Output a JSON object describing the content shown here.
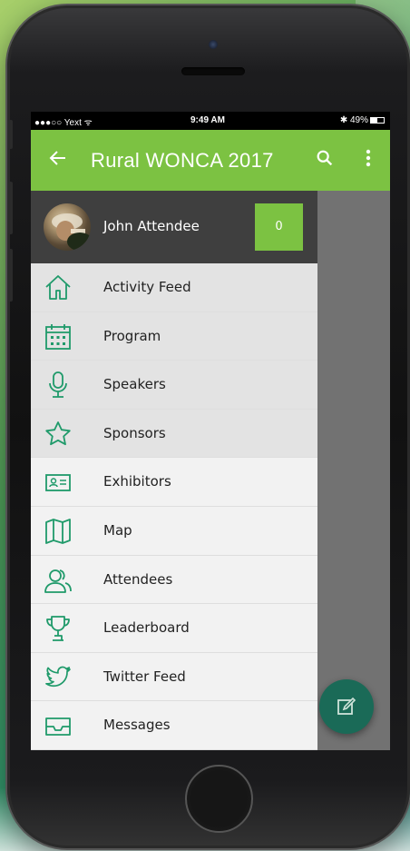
{
  "status_bar": {
    "carrier": "●●●○○ Yext",
    "wifi": "ᯤ",
    "time": "9:49 AM",
    "battery": "✱ 49%"
  },
  "app_bar": {
    "title": "Rural WONCA 2017",
    "color": "#7cc242"
  },
  "drawer": {
    "user_name": "John Attendee",
    "points": "0",
    "items": [
      {
        "label": "Activity Feed",
        "icon": "home-icon"
      },
      {
        "label": "Program",
        "icon": "calendar-icon"
      },
      {
        "label": "Speakers",
        "icon": "microphone-icon"
      },
      {
        "label": "Sponsors",
        "icon": "star-icon"
      },
      {
        "label": "Exhibitors",
        "icon": "id-card-icon"
      },
      {
        "label": "Map",
        "icon": "map-icon"
      },
      {
        "label": "Attendees",
        "icon": "people-icon"
      },
      {
        "label": "Leaderboard",
        "icon": "trophy-icon"
      },
      {
        "label": "Twitter Feed",
        "icon": "twitter-icon"
      },
      {
        "label": "Messages",
        "icon": "inbox-icon"
      }
    ]
  },
  "fab": {
    "icon": "edit-icon",
    "color": "#1a6a57"
  },
  "icon_color": "#1f9a6a"
}
